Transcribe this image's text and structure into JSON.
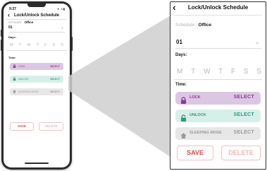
{
  "status_bar": {
    "time": "9:27",
    "icons": "▾ ..ll ▮"
  },
  "header": {
    "back_icon": "chevron-left-icon",
    "title": "Lock/Unlock Schedule"
  },
  "schedule": {
    "label": "Schedule : ",
    "name": "Office"
  },
  "schedule_select": {
    "value": "01",
    "icon": "chevron-down-icon"
  },
  "days": {
    "label": "Days:",
    "items": [
      "M",
      "T",
      "W",
      "T",
      "F",
      "S",
      "S"
    ]
  },
  "time": {
    "label": "Time:"
  },
  "modes": [
    {
      "name": "LOCK",
      "action": "SELECT",
      "icon": "lock-icon",
      "bg": "#dcc7e3",
      "fg": "#8a3c97"
    },
    {
      "name": "UNLOCK",
      "action": "SELECT",
      "icon": "unlock-icon",
      "bg": "#d7efe9",
      "fg": "#2f9a7b"
    },
    {
      "name": "SLEEPING MODE",
      "action": "SELECT",
      "icon": "home-icon",
      "bg": "#e7e7e7",
      "fg": "#9a9a9a"
    }
  ],
  "actions": {
    "save": "SAVE",
    "delete": "DELETE",
    "save_color": "#d24b48",
    "delete_color": "#f3b6b4"
  }
}
